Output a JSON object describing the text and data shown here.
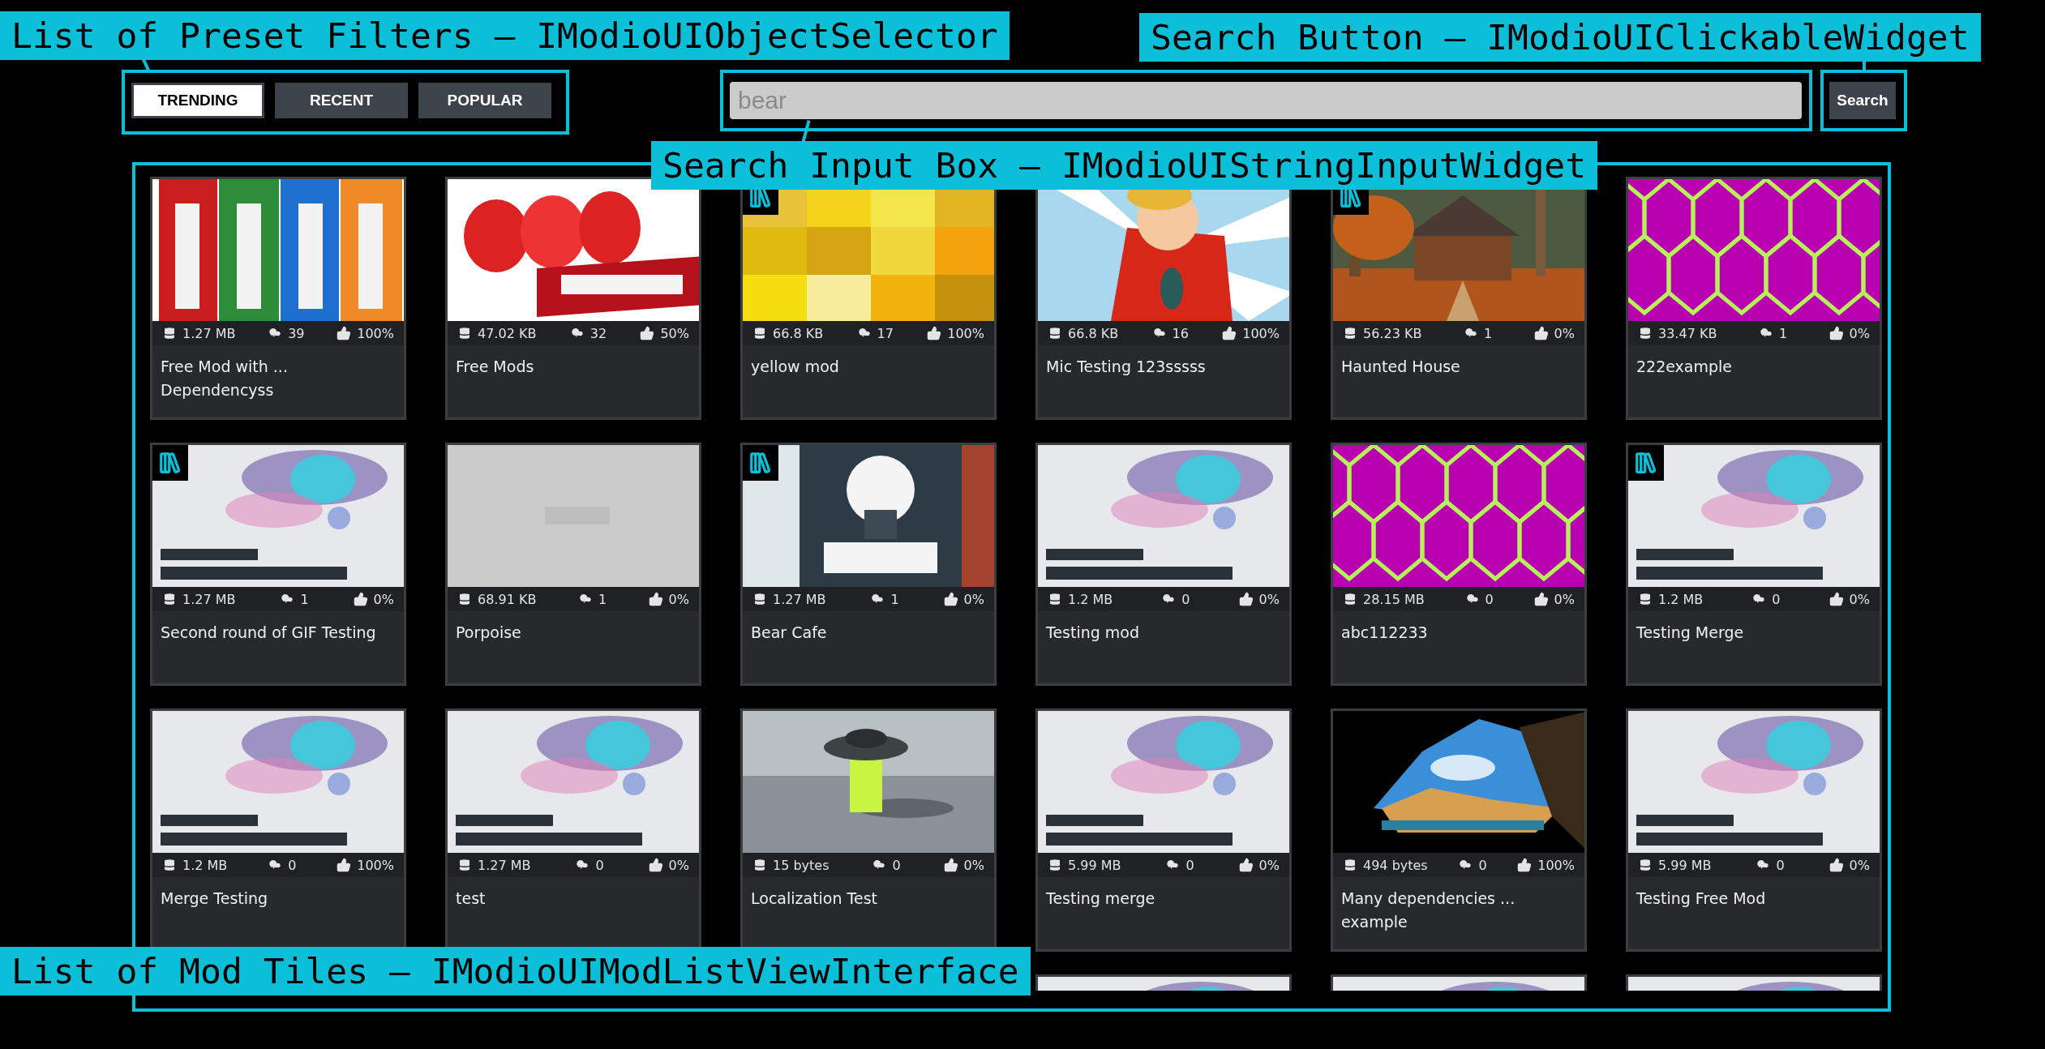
{
  "annotations": [
    {
      "label": "List of Preset Filters – IModioUIObjectSelector"
    },
    {
      "label": "Search Button – IModioUIClickableWidget"
    },
    {
      "label": "Search Input Box – IModioUIStringInputWidget"
    },
    {
      "label": "List of Mod Tiles – IModioUIModListViewInterface"
    }
  ],
  "filters": [
    {
      "label": "TRENDING",
      "selected": true
    },
    {
      "label": "RECENT",
      "selected": false
    },
    {
      "label": "POPULAR",
      "selected": false
    }
  ],
  "search": {
    "placeholder": "bear",
    "button": "Search"
  },
  "mods": [
    {
      "title_lines": [
        "Free Mod with ...",
        "Dependencyss"
      ],
      "size": "1.27 MB",
      "downloads": "39",
      "rating": "100%",
      "collection": false
    },
    {
      "title_lines": [
        "Free Mods"
      ],
      "size": "47.02 KB",
      "downloads": "32",
      "rating": "50%",
      "collection": false
    },
    {
      "title_lines": [
        "yellow mod"
      ],
      "size": "66.8 KB",
      "downloads": "17",
      "rating": "100%",
      "collection": true
    },
    {
      "title_lines": [
        "Mic Testing 123sssss"
      ],
      "size": "66.8 KB",
      "downloads": "16",
      "rating": "100%",
      "collection": false
    },
    {
      "title_lines": [
        "Haunted House"
      ],
      "size": "56.23 KB",
      "downloads": "1",
      "rating": "0%",
      "collection": true
    },
    {
      "title_lines": [
        "222example"
      ],
      "size": "33.47 KB",
      "downloads": "1",
      "rating": "0%",
      "collection": false
    },
    {
      "title_lines": [
        "Second round of GIF Testing"
      ],
      "size": "1.27 MB",
      "downloads": "1",
      "rating": "0%",
      "collection": true
    },
    {
      "title_lines": [
        "Porpoise"
      ],
      "size": "68.91 KB",
      "downloads": "1",
      "rating": "0%",
      "collection": false
    },
    {
      "title_lines": [
        "Bear Cafe"
      ],
      "size": "1.27 MB",
      "downloads": "1",
      "rating": "0%",
      "collection": true
    },
    {
      "title_lines": [
        "Testing mod"
      ],
      "size": "1.2 MB",
      "downloads": "0",
      "rating": "0%",
      "collection": false
    },
    {
      "title_lines": [
        "abc112233"
      ],
      "size": "28.15 MB",
      "downloads": "0",
      "rating": "0%",
      "collection": false
    },
    {
      "title_lines": [
        "Testing Merge"
      ],
      "size": "1.2 MB",
      "downloads": "0",
      "rating": "0%",
      "collection": true
    },
    {
      "title_lines": [
        "Merge Testing"
      ],
      "size": "1.2 MB",
      "downloads": "0",
      "rating": "100%",
      "collection": false
    },
    {
      "title_lines": [
        "test"
      ],
      "size": "1.27 MB",
      "downloads": "0",
      "rating": "0%",
      "collection": false
    },
    {
      "title_lines": [
        "Localization Test"
      ],
      "size": "15 bytes",
      "downloads": "0",
      "rating": "0%",
      "collection": false
    },
    {
      "title_lines": [
        "Testing merge"
      ],
      "size": "5.99 MB",
      "downloads": "0",
      "rating": "0%",
      "collection": false
    },
    {
      "title_lines": [
        "Many dependencies ...",
        "example"
      ],
      "size": "494 bytes",
      "downloads": "0",
      "rating": "100%",
      "collection": false
    },
    {
      "title_lines": [
        "Testing Free Mod"
      ],
      "size": "5.99 MB",
      "downloads": "0",
      "rating": "0%",
      "collection": false
    }
  ]
}
